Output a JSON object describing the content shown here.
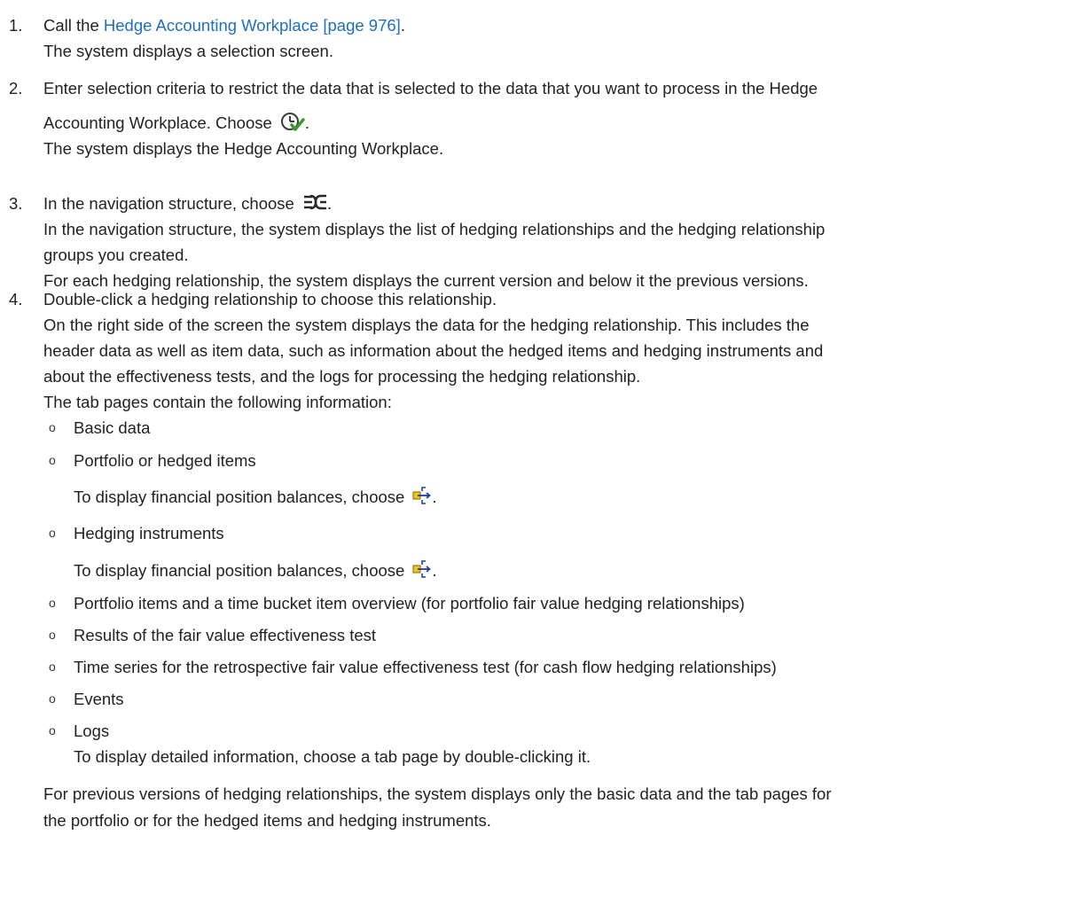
{
  "steps": [
    {
      "num": "1.",
      "call_prefix": "Call the ",
      "link_text": "Hedge Accounting Workplace [page 976]",
      "call_suffix": ".",
      "line2": "The system displays a selection screen."
    },
    {
      "num": "2.",
      "line1": "Enter selection criteria to restrict the data that is selected to the data that you want to process in the Hedge",
      "line2_prefix": "Accounting Workplace. Choose ",
      "line2_suffix": ".",
      "line3": "The system displays the Hedge Accounting Workplace."
    },
    {
      "num": "3.",
      "line1_prefix": "In the navigation structure, choose ",
      "line1_suffix": ".",
      "line2": "In the navigation structure, the system displays the list of hedging relationships and the hedging relationship",
      "line3": "groups you created.",
      "line4": "For each hedging relationship, the system displays the current version and below it the previous versions."
    },
    {
      "num": "4.",
      "line1": "Double-click a hedging relationship to choose this relationship.",
      "line2": "On the right side of the screen the system displays the data for the hedging relationship. This includes the",
      "line3": "header data as well as item data, such as information about the hedged items and hedging instruments and",
      "line4": "about the effectiveness tests, and the logs for processing the hedging relationship.",
      "line5": "The tab pages contain the following information:"
    }
  ],
  "bullets": [
    {
      "label": "Basic data"
    },
    {
      "label": "Portfolio or hedged items",
      "sub_prefix": "To display financial position balances, choose ",
      "sub_suffix": "."
    },
    {
      "label": "Hedging instruments",
      "sub_prefix": "To display financial position balances, choose ",
      "sub_suffix": "."
    },
    {
      "label": "Portfolio items and a time bucket item overview (for portfolio fair value hedging relationships)"
    },
    {
      "label": "Results of the fair value effectiveness test"
    },
    {
      "label": "Time series for the retrospective fair value effectiveness test (for cash flow hedging relationships)"
    },
    {
      "label": "Events"
    },
    {
      "label": "Logs",
      "sub_text": "To display detailed information, choose a tab page by double-clicking it."
    }
  ],
  "closing": {
    "line1": "For previous versions of hedging relationships, the system displays only the basic data and the tab pages for",
    "line2": "the portfolio or for the hedged items and hedging instruments."
  },
  "bullet_glyph": "o",
  "icons": {
    "execute": "execute-clock-check-icon",
    "hierarchy": "hedging-relationship-hierarchy-icon",
    "balances": "financial-position-balances-icon"
  },
  "colors": {
    "link": "#1f6fbf",
    "text": "#222222"
  }
}
